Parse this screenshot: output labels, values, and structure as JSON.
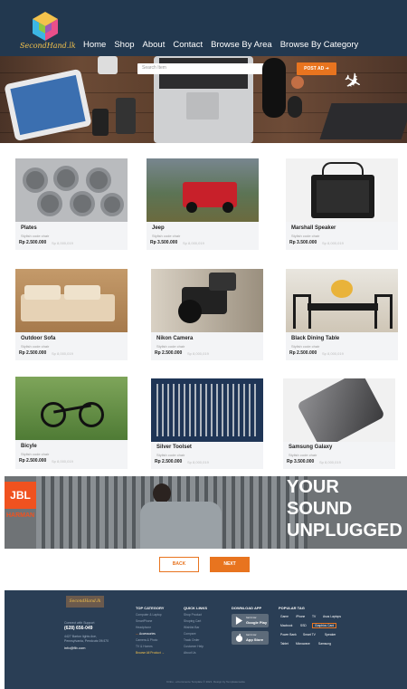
{
  "brand": {
    "name": "SecondHand.lk"
  },
  "nav": [
    "Home",
    "Shop",
    "About",
    "Contact",
    "Browse By Area",
    "Browse By Category"
  ],
  "search": {
    "placeholder": "Search Item"
  },
  "post_ad": "POST AD",
  "products": [
    {
      "title": "Plates",
      "subtitle": "Stylish code chair",
      "price": "Rp 2.500.000",
      "date": "Sp 8,000,019"
    },
    {
      "title": "Jeep",
      "subtitle": "Stylish code chair",
      "price": "Rp 3.500.000",
      "date": "Sp 8,000,019"
    },
    {
      "title": "Marshall Speaker",
      "subtitle": "Stylish code chair",
      "price": "Rp 3.500.000",
      "date": "Sp 8,000,019"
    },
    {
      "title": "Outdoor Sofa",
      "subtitle": "Stylish code chair",
      "price": "Rp 2.500.000",
      "date": "Sp 8,000,019"
    },
    {
      "title": "Nikon Camera",
      "subtitle": "Stylish code chair",
      "price": "Rp 2.500.000",
      "date": "Sp 8,000,019"
    },
    {
      "title": "Black Dining Table",
      "subtitle": "Stylish code chair",
      "price": "Rp 2.500.000",
      "date": "Sp 8,000,019"
    },
    {
      "title": "Bicyle",
      "subtitle": "Stylish code chair",
      "price": "Rp 2.500.000",
      "date": "Sp 8,000,019"
    },
    {
      "title": "Silver Toolset",
      "subtitle": "Stylish code chair",
      "price": "Rp 2.500.000",
      "date": "Sp 8,000,019"
    },
    {
      "title": "Samsung Galaxy",
      "subtitle": "Stylish code chair",
      "price": "Rp 3.500.000",
      "date": "Sp 8,000,019"
    }
  ],
  "banner": {
    "logo": "JBL",
    "sub_logo": "HARMAN",
    "line1": "YOUR SOUND",
    "line2": "UNPLUGGED"
  },
  "pagination": {
    "back": "BACK",
    "next": "NEXT"
  },
  "footer": {
    "logo": "SecondHand.lk",
    "contact_label": "Connect with Support",
    "phone": "(628) 656-049",
    "address1": "4427 Barton lights Ave,",
    "address2": "Pennsylvania, Pendcuts 09/470",
    "email": "info@fib.com",
    "top_category": {
      "heading": "TOP CATEGORY",
      "items": [
        "Computer & Laptop",
        "SmartPhone",
        "Headphone",
        "Accessories",
        "Camera & Photo",
        "TV & Homes"
      ],
      "browse": "Browse All Product →"
    },
    "quick_links": {
      "heading": "QUICK LINKS",
      "items": [
        "Shop Product",
        "Shoping Cart",
        "Wishlist Bar",
        "Compare",
        "Track Order",
        "Customer Help",
        "About Us"
      ]
    },
    "download": {
      "heading": "DOWNLOAD APP",
      "google": {
        "t1": "Get it now",
        "t2": "Google Play"
      },
      "apple": {
        "t1": "Get it now",
        "t2": "App Store"
      }
    },
    "popular_tag": {
      "heading": "POPULAR TAG",
      "tags": [
        "Game",
        "iPhone",
        "TV",
        "Asus Laptops",
        "Macbook",
        "SSD",
        "Graphics Card",
        "Power Bank",
        "Smart TV",
        "Speaker",
        "Tablet",
        "Microwave",
        "Samsung"
      ]
    },
    "copyright": "Kinbo - eCommerce Template © 2021. Design by Templatecookie"
  }
}
